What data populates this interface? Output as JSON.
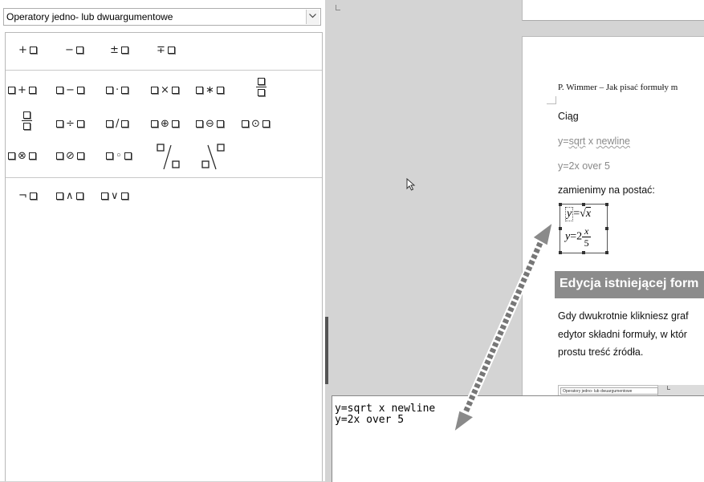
{
  "elements_panel": {
    "category": "Operatory jedno- lub dwuargumentowe",
    "row1": [
      {
        "id": "plus",
        "pre": "+"
      },
      {
        "id": "minus",
        "pre": "−"
      },
      {
        "id": "plusminus",
        "pre": "±"
      },
      {
        "id": "minusplus",
        "pre": "∓"
      }
    ],
    "row2": [
      {
        "id": "add",
        "op": "+"
      },
      {
        "id": "sub",
        "op": "−"
      },
      {
        "id": "cdot",
        "op": "·"
      },
      {
        "id": "times",
        "op": "×"
      },
      {
        "id": "ast",
        "op": "∗"
      }
    ],
    "row3": [
      {
        "id": "div",
        "op": "÷"
      },
      {
        "id": "slash",
        "op": "/"
      },
      {
        "id": "oplus",
        "op": "⊕"
      },
      {
        "id": "ominus",
        "op": "⊖"
      },
      {
        "id": "odot",
        "op": "⊙"
      }
    ],
    "row4": [
      {
        "id": "otimes",
        "op": "⊗"
      },
      {
        "id": "oslash",
        "op": "⊘"
      },
      {
        "id": "circ",
        "op": "◦"
      }
    ],
    "logic_neg": "¬",
    "logic_and": "∧",
    "logic_or": "∨"
  },
  "document": {
    "header_line": "P. Wimmer – Jak pisać formuły m",
    "ciag": "Ciąg",
    "line1_pre": "y=",
    "line1_sqrt": "sqrt",
    "line1_mid": " x ",
    "line1_newline": "newline",
    "line2": "y=2x over 5",
    "transform": "zamienimy na postać:",
    "formula": {
      "y1": "y",
      "eq1": "=",
      "sqrt": "√",
      "x1": "x",
      "y2": "y",
      "eq2": "=",
      "two": "2",
      "num": "x",
      "den": "5"
    },
    "heading": "Edycja istniejącej form",
    "para": [
      "Gdy dwukrotnie klikniesz graf",
      "edytor składni formuły, w któr",
      "prostu treść źródła."
    ],
    "mini_select": "Operatory jedno- lub dwuargumentowe"
  },
  "command_editor": {
    "text": "y=sqrt x newline\ny=2x over 5"
  }
}
